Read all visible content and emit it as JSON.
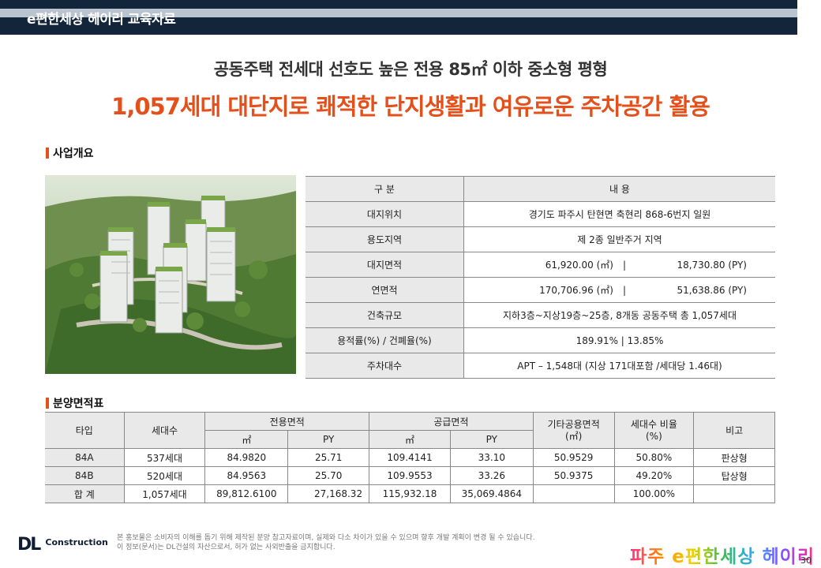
{
  "header": {
    "title": "e편한세상 헤이리 교육자료"
  },
  "subtitle": "공동주택 전세대 선호도 높은 전용 85㎡ 이하 중소형 평형",
  "headline": "1,057세대 대단지로 쾌적한 단지생활과 여유로운 주차공간 활용",
  "section_overview": "사업개요",
  "overview": {
    "head": [
      "구    분",
      "내       용"
    ],
    "rows": [
      {
        "label": "대지위치",
        "value": "경기도 파주시 탄현면 축현리 868-6번지 일원"
      },
      {
        "label": "용도지역",
        "value": "제 2종 일반주거 지역"
      },
      {
        "label": "대지면적",
        "value": "61,920.00 (㎡)",
        "value2": "18,730.80 (PY)"
      },
      {
        "label": "연면적",
        "value": "170,706.96 (㎡)",
        "value2": "51,638.86 (PY)"
      },
      {
        "label": "건축규모",
        "value": "지하3층~지상19층~25층, 8개동 공동주택 총 1,057세대"
      },
      {
        "label": "용적률(%) / 건폐율(%)",
        "value": "189.91%   |   13.85%"
      },
      {
        "label": "주차대수",
        "value": "APT – 1,548대 (지상 171대포함 /세대당 1.46대)"
      }
    ],
    "separator": "|"
  },
  "section_areas": "분양면적표",
  "areas": {
    "h_type": "타입",
    "h_units": "세대수",
    "h_exclusive": "전용면적",
    "h_supply": "공급면적",
    "h_common": "기타공용면적\n(㎡)",
    "h_ratio": "세대수 비율\n(%)",
    "h_note": "비고",
    "u_m2": "㎡",
    "u_py": "PY",
    "rows": [
      {
        "type": "84A",
        "units": "537세대",
        "ex_m2": "84.9820",
        "ex_py": "25.71",
        "sup_m2": "109.4141",
        "sup_py": "33.10",
        "common": "50.9529",
        "ratio": "50.80%",
        "note": "판상형"
      },
      {
        "type": "84B",
        "units": "520세대",
        "ex_m2": "84.9563",
        "ex_py": "25.70",
        "sup_m2": "109.9553",
        "sup_py": "33.26",
        "common": "50.9375",
        "ratio": "49.20%",
        "note": "탑상형"
      }
    ],
    "total": {
      "type": "합 계",
      "units": "1,057세대",
      "ex_m2": "89,812.6100",
      "ex_py": "27,168.32",
      "sup_m2": "115,932.18",
      "sup_py": "35,069.4864",
      "common": "",
      "ratio": "100.00%",
      "note": ""
    }
  },
  "footer": {
    "logo_dl": "DL",
    "logo_text": "Construction",
    "disclaimer_1": "본 홍보물은 소비자의 이해를 돕기 위해 제작된 분양 참고자료이며, 실제와 다소 차이가 있을 수 있으며 향후 개발 계획이 변경 될 수 있습니다.",
    "disclaimer_2": "이 정보(문서)는 DL건설의 자산으로서, 허가 없는 사외반출을 금지합니다.",
    "brand": "파주 e편한세상 헤이리",
    "page": "30"
  },
  "colors": {
    "accent": "#e4501c",
    "navy": "#13253a",
    "table_header": "#e9e9e9"
  }
}
